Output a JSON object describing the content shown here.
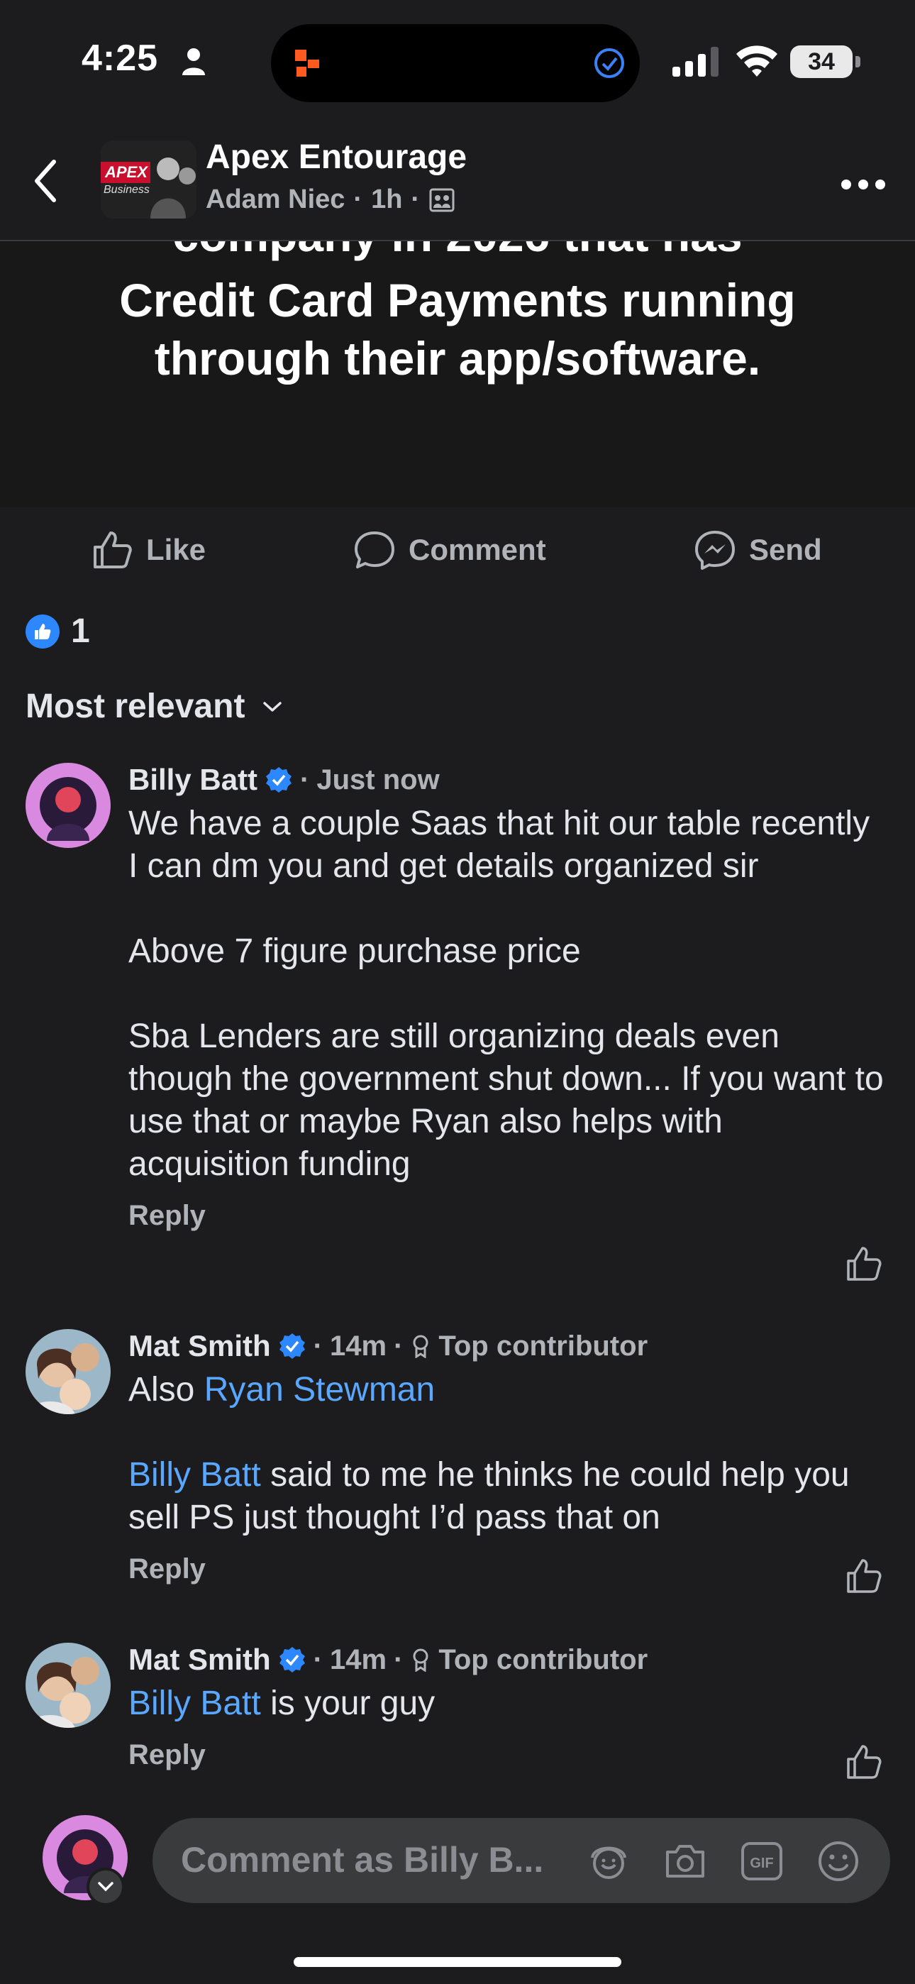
{
  "status_bar": {
    "time": "4:25",
    "battery": "34"
  },
  "header": {
    "group_name": "Apex Entourage",
    "author": "Adam Niec",
    "time": "1h",
    "thumb_text_1": "APEX",
    "thumb_text_2": "Business"
  },
  "post_image": {
    "cut_line": "company in 2026 that has",
    "line_1": "Credit Card Payments running",
    "line_2": "through their app/software."
  },
  "actions": {
    "like": "Like",
    "comment": "Comment",
    "send": "Send"
  },
  "reactions": {
    "count": "1"
  },
  "sort": {
    "label": "Most relevant"
  },
  "comments": [
    {
      "name": "Billy Batt",
      "time": "Just now",
      "text": "We have a couple Saas that hit our table recently I can dm you and get details organized sir\n\nAbove 7 figure purchase price\n\nSba Lenders are still organizing deals even though the government shut down... If you want to use that or maybe Ryan also helps with acquisition funding",
      "reply": "Reply"
    },
    {
      "name": "Mat Smith",
      "time": "14m",
      "badge": "Top contributor",
      "text_pre": "Also ",
      "mention_1": "Ryan Stewman",
      "mention_2": "Billy Batt",
      "text_post": " said to me he thinks he could help you sell PS just thought I’d pass that on",
      "reply": "Reply"
    },
    {
      "name": "Mat Smith",
      "time": "14m",
      "badge": "Top contributor",
      "mention": "Billy Batt",
      "text_post": " is your guy",
      "reply": "Reply"
    }
  ],
  "composer": {
    "placeholder": "Comment as Billy B..."
  },
  "colors": {
    "accent": "#2d88ff",
    "mention": "#5aa7ff",
    "background": "#1c1c1e"
  }
}
